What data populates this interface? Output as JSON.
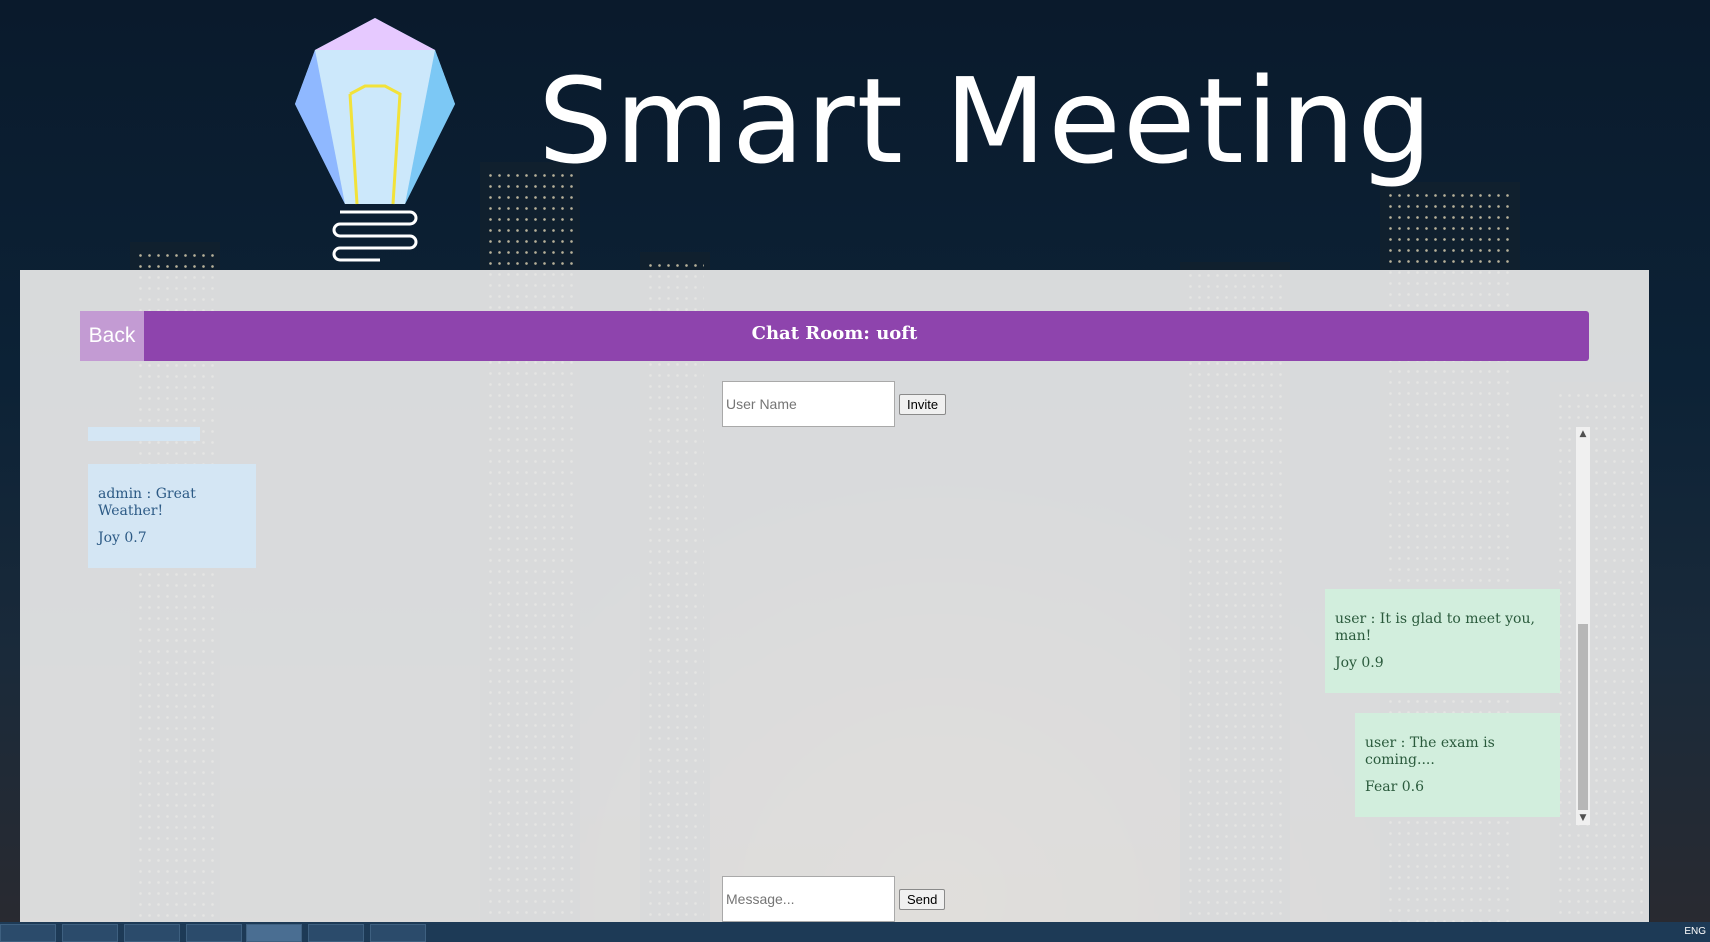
{
  "header": {
    "title": "Smart Meeting"
  },
  "chat_room": {
    "back_label": "Back",
    "title": "Chat Room: uoft"
  },
  "invite": {
    "user_placeholder": "User Name",
    "invite_label": "Invite"
  },
  "messages": [
    {
      "text": "admin : Great Weather!",
      "emotion": "Joy 0.7",
      "side": "left"
    },
    {
      "text": "user : It is glad to meet you, man!",
      "emotion": "Joy 0.9",
      "side": "right"
    },
    {
      "text": "user : The exam is coming....",
      "emotion": "Fear 0.6",
      "side": "right"
    }
  ],
  "compose": {
    "message_placeholder": "Message...",
    "send_label": "Send"
  },
  "taskbar": {
    "lang": "ENG"
  },
  "colors": {
    "bar": "#8e44ad",
    "back_button": "#c39bd3",
    "bubble_admin": "#d4e6f4",
    "bubble_user": "#d2eedd"
  }
}
